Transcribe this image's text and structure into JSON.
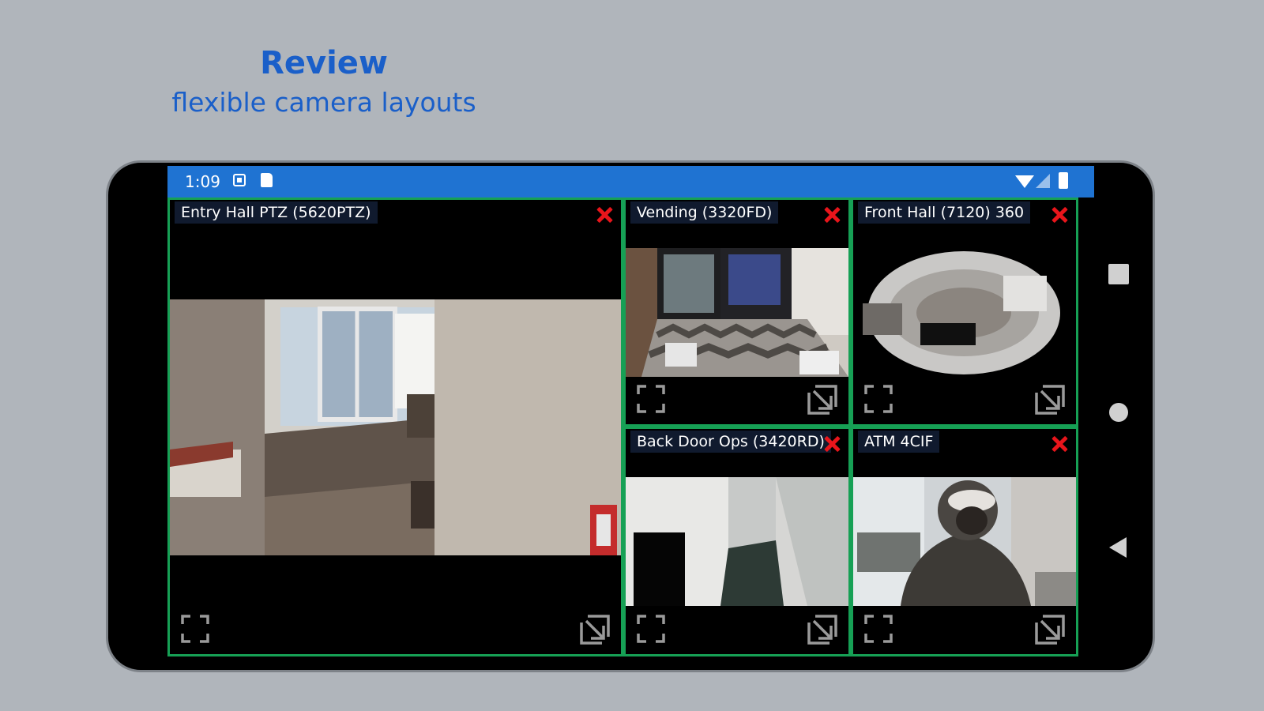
{
  "promo": {
    "title": "Review",
    "subtitle": "flexible camera layouts",
    "color": "#1a5fc9"
  },
  "status_bar": {
    "time": "1:09",
    "icons_left": [
      "notification-icon",
      "sd-card-icon"
    ],
    "icons_right": [
      "wifi-icon",
      "signal-icon",
      "battery-icon"
    ],
    "color": "#1f73d2"
  },
  "tiles": [
    {
      "label": "Entry Hall PTZ (5620PTZ)",
      "icons": [
        "close-icon",
        "fullscreen-icon",
        "popout-icon"
      ]
    },
    {
      "label": "Vending (3320FD)",
      "icons": [
        "close-icon",
        "fullscreen-icon",
        "popout-icon"
      ]
    },
    {
      "label": "Front Hall (7120) 360",
      "icons": [
        "close-icon",
        "fullscreen-icon",
        "popout-icon"
      ]
    },
    {
      "label": "Back Door Ops (3420RD)",
      "icons": [
        "close-icon",
        "fullscreen-icon",
        "popout-icon"
      ]
    },
    {
      "label": "ATM 4CIF",
      "icons": [
        "close-icon",
        "fullscreen-icon",
        "popout-icon"
      ]
    }
  ],
  "nav_bar": {
    "icons": [
      "recents-square-icon",
      "home-circle-icon",
      "back-triangle-icon"
    ]
  },
  "colors": {
    "tile_border": "#16a055",
    "close": "#e8151b",
    "page_background": "#b0b5bb"
  }
}
